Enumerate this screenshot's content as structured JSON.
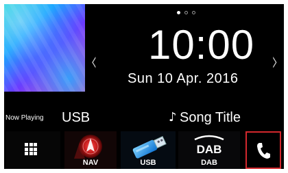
{
  "album_art": {
    "icon": "album-art-image"
  },
  "pager": {
    "pages": 3,
    "active_page": 1
  },
  "clock": {
    "time": "10:00",
    "date": "Sun 10 Apr. 2016"
  },
  "now_playing": {
    "label": "Now Playing",
    "source": "USB",
    "note_icon": "music-note-icon",
    "song_title": "Song Title"
  },
  "launcher": {
    "menu_icon": "grid-menu-icon",
    "items": [
      {
        "label": "NAV",
        "icon": "navigation-icon"
      },
      {
        "label": "USB",
        "icon": "usb-stick-icon"
      },
      {
        "label": "DAB",
        "icon": "dab-logo-icon",
        "logo_text": "DAB"
      }
    ],
    "phone_icon": "phone-icon",
    "highlight_color": "#d4282d"
  }
}
